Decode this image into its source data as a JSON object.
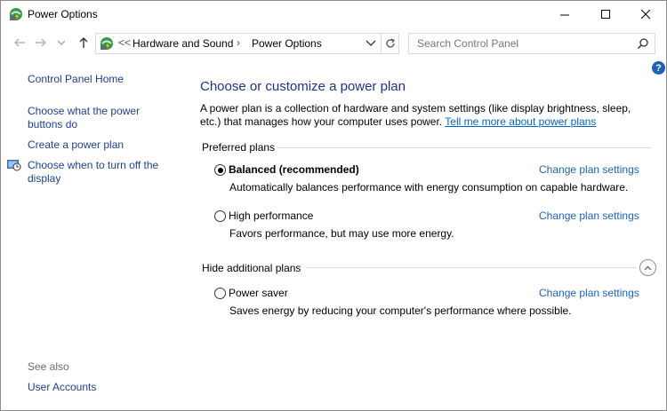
{
  "window": {
    "title": "Power Options"
  },
  "address": {
    "crumb_sep": "<<",
    "crumbs": [
      "Hardware and Sound",
      "Power Options"
    ],
    "arrow": "›"
  },
  "search": {
    "placeholder": "Search Control Panel"
  },
  "help": {
    "label": "?"
  },
  "sidebar": {
    "home": "Control Panel Home",
    "links": [
      "Choose what the power buttons do",
      "Create a power plan",
      "Choose when to turn off the display"
    ],
    "see_also_label": "See also",
    "see_also": [
      "User Accounts"
    ]
  },
  "main": {
    "heading": "Choose or customize a power plan",
    "description": "A power plan is a collection of hardware and system settings (like display brightness, sleep, etc.) that manages how your computer uses power.",
    "learn_more": "Tell me more about power plans",
    "preferred_label": "Preferred plans",
    "additional_label": "Hide additional plans",
    "plans": [
      {
        "name": "Balanced (recommended)",
        "desc": "Automatically balances performance with energy consumption on capable hardware.",
        "link": "Change plan settings",
        "selected": true
      },
      {
        "name": "High performance",
        "desc": "Favors performance, but may use more energy.",
        "link": "Change plan settings",
        "selected": false
      },
      {
        "name": "Power saver",
        "desc": "Saves energy by reducing your computer's performance where possible.",
        "link": "Change plan settings",
        "selected": false
      }
    ]
  },
  "colors": {
    "link": "#1c3f94",
    "heading": "#1e3287",
    "accent": "#1c63b8"
  }
}
